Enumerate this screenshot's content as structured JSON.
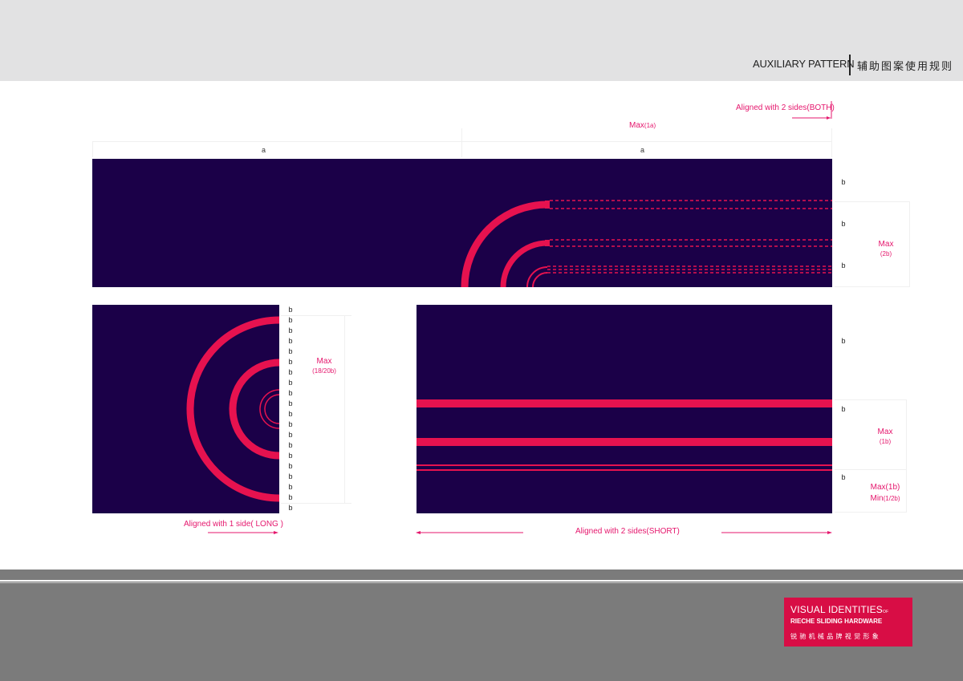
{
  "header": {
    "title_en": "AUXILIARY PATTERN",
    "title_cn": "辅助图案使用规则"
  },
  "top_panel": {
    "aligned_label": "Aligned with 2 sides(BOTH)",
    "max_label": "Max",
    "max_sub": "(1a)",
    "col_labels": [
      "a",
      "a"
    ],
    "row_labels": [
      "b",
      "b",
      "b"
    ],
    "side_max": "Max",
    "side_max_sub": "(2b)"
  },
  "left_panel": {
    "row_letter": "b",
    "row_count": 20,
    "side_max": "Max",
    "side_max_sub": "(18/20b)",
    "aligned_label": "Aligned with 1 side( LONG )"
  },
  "right_panel": {
    "row_labels": [
      "b",
      "b",
      "b"
    ],
    "max_label": "Max",
    "max_sub": "(1b)",
    "max2_label": "Max(1b)",
    "min_label": "Min",
    "min_sub": "(1/2b)",
    "aligned_label": "Aligned with  2 sides(SHORT)"
  },
  "colors": {
    "panel": "#1b0048",
    "accent": "#e6124f",
    "annotation": "#e5176d",
    "logo_bg": "#d80d45",
    "footer": "#7b7b7b"
  },
  "logo": {
    "line1": "VISUAL IDENTITIES",
    "line1_of": "OF",
    "line2": "RIECHE SLIDING HARDWARE",
    "line3": "锐驰机械品牌视觉形象"
  }
}
